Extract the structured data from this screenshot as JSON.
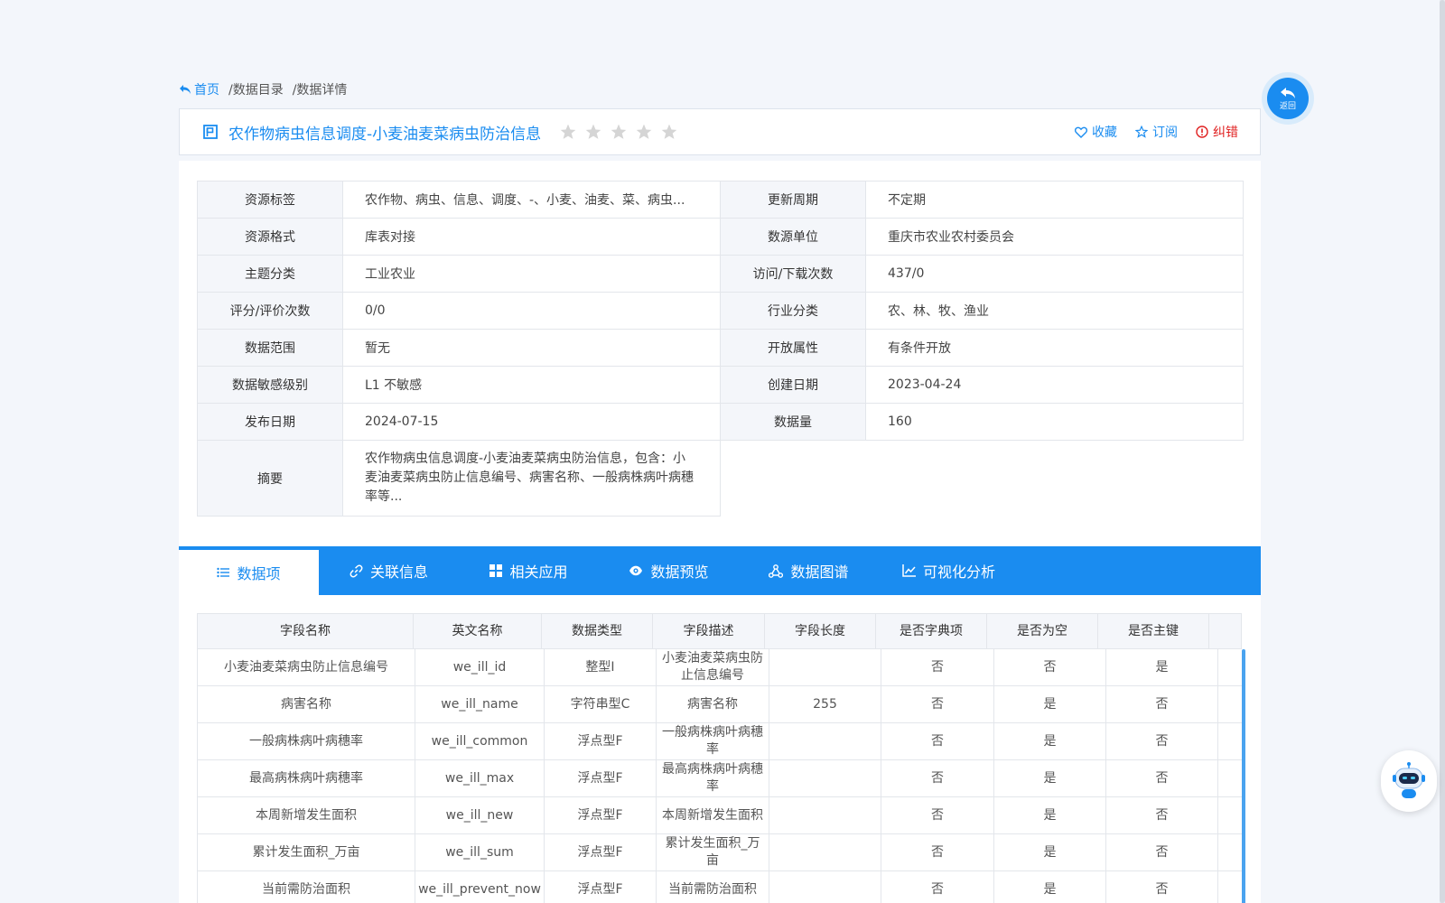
{
  "breadcrumb": {
    "home": "首页",
    "catalog": "/数据目录",
    "detail": "/数据详情"
  },
  "title": "农作物病虫信息调度-小麦油麦菜病虫防治信息",
  "rating": {
    "stars": 5,
    "filled": 0
  },
  "actions": {
    "favorite": "收藏",
    "subscribe": "订阅",
    "error": "纠错"
  },
  "info": {
    "rows": [
      {
        "l1": "资源标签",
        "v1": "农作物、病虫、信息、调度、-、小麦、油麦、菜、病虫...",
        "l2": "更新周期",
        "v2": "不定期"
      },
      {
        "l1": "资源格式",
        "v1": "库表对接",
        "l2": "数源单位",
        "v2": "重庆市农业农村委员会"
      },
      {
        "l1": "主题分类",
        "v1": "工业农业",
        "l2": "访问/下载次数",
        "v2": "437/0"
      },
      {
        "l1": "评分/评价次数",
        "v1": "0/0",
        "l2": "行业分类",
        "v2": "农、林、牧、渔业"
      },
      {
        "l1": "数据范围",
        "v1": "暂无",
        "l2": "开放属性",
        "v2": "有条件开放"
      },
      {
        "l1": "数据敏感级别",
        "v1": "L1 不敏感",
        "l2": "创建日期",
        "v2": "2023-04-24"
      },
      {
        "l1": "发布日期",
        "v1": "2024-07-15",
        "l2": "数据量",
        "v2": "160"
      }
    ],
    "abstract_label": "摘要",
    "abstract": "农作物病虫信息调度-小麦油麦菜病虫防治信息，包含：小麦油麦菜病虫防止信息编号、病害名称、一般病株病叶病穗率等..."
  },
  "tabs": [
    "数据项",
    "关联信息",
    "相关应用",
    "数据预览",
    "数据图谱",
    "可视化分析"
  ],
  "grid": {
    "headers": [
      "字段名称",
      "英文名称",
      "数据类型",
      "字段描述",
      "字段长度",
      "是否字典项",
      "是否为空",
      "是否主键"
    ],
    "rows": [
      [
        "小麦油麦菜病虫防止信息编号",
        "we_ill_id",
        "整型I",
        "小麦油麦菜病虫防止信息编号",
        "",
        "否",
        "否",
        "是"
      ],
      [
        "病害名称",
        "we_ill_name",
        "字符串型C",
        "病害名称",
        "255",
        "否",
        "是",
        "否"
      ],
      [
        "一般病株病叶病穗率",
        "we_ill_common",
        "浮点型F",
        "一般病株病叶病穗率",
        "",
        "否",
        "是",
        "否"
      ],
      [
        "最高病株病叶病穗率",
        "we_ill_max",
        "浮点型F",
        "最高病株病叶病穗率",
        "",
        "否",
        "是",
        "否"
      ],
      [
        "本周新增发生面积",
        "we_ill_new",
        "浮点型F",
        "本周新增发生面积",
        "",
        "否",
        "是",
        "否"
      ],
      [
        "累计发生面积_万亩",
        "we_ill_sum",
        "浮点型F",
        "累计发生面积_万亩",
        "",
        "否",
        "是",
        "否"
      ],
      [
        "当前需防治面积",
        "we_ill_prevent_now",
        "浮点型F",
        "当前需防治面积",
        "",
        "否",
        "是",
        "否"
      ]
    ]
  },
  "back_label": "返回",
  "colors": {
    "accent": "#1a8cf0",
    "error": "#e02020",
    "star": "#d5d5d5"
  }
}
